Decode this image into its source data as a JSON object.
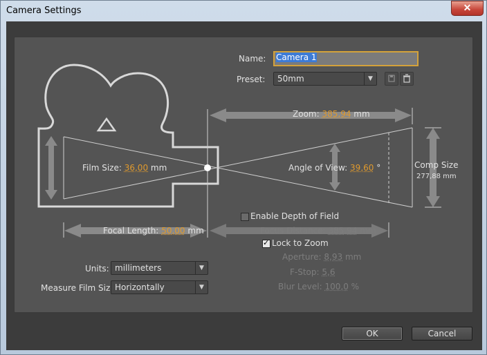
{
  "window": {
    "title": "Camera Settings",
    "close_glyph": "✕"
  },
  "name": {
    "label": "Name:",
    "value": "Camera 1"
  },
  "preset": {
    "label": "Preset:",
    "value": "50mm",
    "save_icon": "save-preset-icon",
    "delete_icon": "trash-icon"
  },
  "zoom": {
    "label": "Zoom:",
    "value": "385,94",
    "unit": "mm"
  },
  "film_size": {
    "label": "Film Size:",
    "value": "36,00",
    "unit": "mm"
  },
  "angle_of_view": {
    "label": "Angle of View:",
    "value": "39,60",
    "unit": "°"
  },
  "comp_size": {
    "label": "Comp Size",
    "value": "277,88 mm"
  },
  "focal_length": {
    "label": "Focal Length:",
    "value": "50,00",
    "unit": "mm"
  },
  "depth_of_field": {
    "label": "Enable Depth of Field",
    "checked": false
  },
  "focus_distance": {
    "label": "Focus Distance:",
    "value": "385,94",
    "unit": "mm"
  },
  "lock_to_zoom": {
    "label": "Lock to Zoom",
    "checked": true
  },
  "aperture": {
    "label": "Aperture:",
    "value": "8,93",
    "unit": "mm"
  },
  "fstop": {
    "label": "F-Stop:",
    "value": "5,6"
  },
  "blur_level": {
    "label": "Blur Level:",
    "value": "100,0",
    "unit": "%"
  },
  "units": {
    "label": "Units:",
    "value": "millimeters"
  },
  "measure_film_size": {
    "label": "Measure Film Size:",
    "value": "Horizontally"
  },
  "buttons": {
    "ok": "OK",
    "cancel": "Cancel"
  },
  "colors": {
    "panel": "#545454",
    "accent_value": "#e09a2d",
    "focus_border": "#d4a23a",
    "selection": "#3d7bd6"
  }
}
